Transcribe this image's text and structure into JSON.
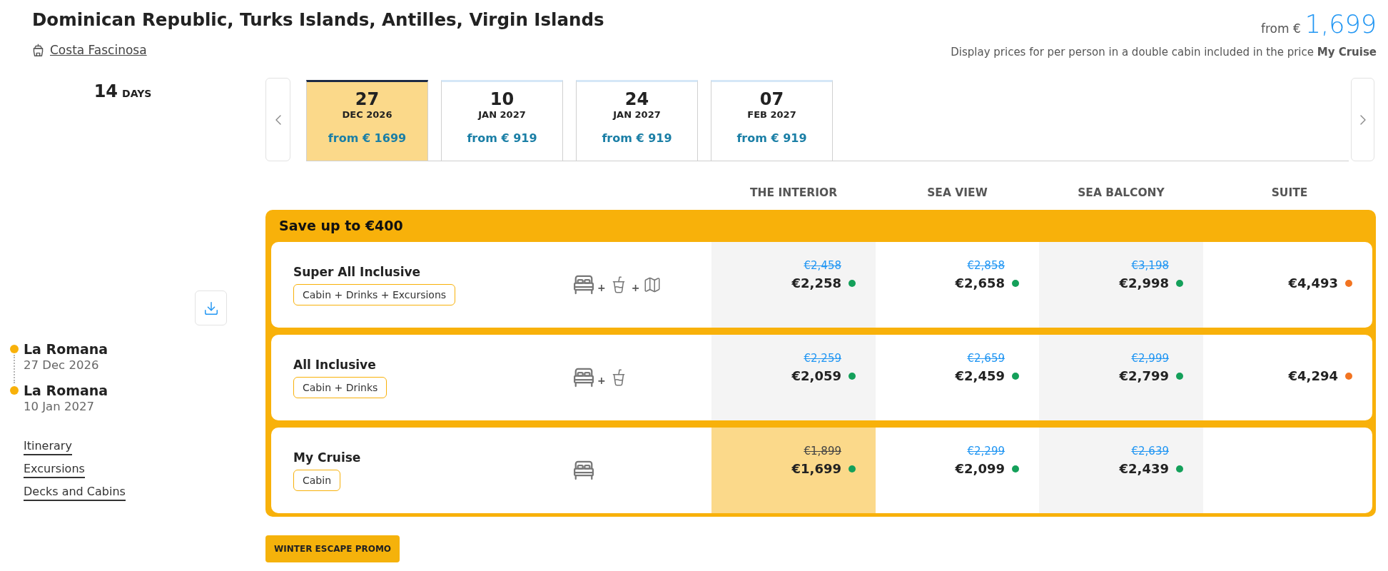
{
  "header": {
    "title": "Dominican Republic, Turks Islands, Antilles, Virgin Islands",
    "ship": "Costa Fascinosa",
    "from_label": "from €",
    "from_price": "1,699",
    "note": "Display prices for per person in a double cabin included in the price **My Cruise**"
  },
  "duration": {
    "number": "14",
    "unit": "DAYS"
  },
  "departures": [
    {
      "day": "27",
      "month": "DEC 2026",
      "price": "from € 1699",
      "selected": true
    },
    {
      "day": "10",
      "month": "JAN 2027",
      "price": "from € 919",
      "selected": false
    },
    {
      "day": "24",
      "month": "JAN 2027",
      "price": "from € 919",
      "selected": false
    },
    {
      "day": "07",
      "month": "FEB 2027",
      "price": "from € 919",
      "selected": false
    }
  ],
  "cabin_columns": [
    "THE INTERIOR",
    "SEA VIEW",
    "SEA BALCONY",
    "SUITE"
  ],
  "offer": {
    "title": "Save up to €400",
    "packages": [
      {
        "name": "Super All Inclusive",
        "tag": "Cabin + Drinks + Excursions",
        "includes": [
          {
            "kind": "cabin"
          },
          {
            "kind": "drinks",
            "joiner": "+"
          },
          {
            "kind": "excursions",
            "joiner": "+"
          }
        ],
        "prices": [
          {
            "old": "€2,458",
            "price": "€2,258",
            "color": "#14a05a",
            "selected": false
          },
          {
            "old": "€2,858",
            "price": "€2,658",
            "color": "#14a05a",
            "selected": false
          },
          {
            "old": "€3,198",
            "price": "€2,998",
            "color": "#14a05a",
            "selected": false
          },
          {
            "price": "€4,493",
            "color": "#f27421",
            "selected": false
          }
        ]
      },
      {
        "name": "All Inclusive",
        "tag": "Cabin + Drinks",
        "includes": [
          {
            "kind": "cabin"
          },
          {
            "kind": "drinks",
            "joiner": "+"
          }
        ],
        "prices": [
          {
            "old": "€2,259",
            "price": "€2,059",
            "color": "#14a05a",
            "selected": false
          },
          {
            "old": "€2,659",
            "price": "€2,459",
            "color": "#14a05a",
            "selected": false
          },
          {
            "old": "€2,999",
            "price": "€2,799",
            "color": "#14a05a",
            "selected": false
          },
          {
            "price": "€4,294",
            "color": "#f27421",
            "selected": false
          }
        ]
      },
      {
        "name": "My Cruise",
        "tag": "Cabin",
        "includes": [
          {
            "kind": "cabin"
          }
        ],
        "prices": [
          {
            "old": "€1,899",
            "price": "€1,699",
            "color": "#14a05a",
            "selected": true
          },
          {
            "old": "€2,299",
            "price": "€2,099",
            "color": "#14a05a",
            "selected": false
          },
          {
            "old": "€2,639",
            "price": "€2,439",
            "color": "#14a05a",
            "selected": false
          }
        ]
      }
    ]
  },
  "ports": [
    {
      "name": "La Romana",
      "date": "27 Dec 2026"
    },
    {
      "name": "La Romana",
      "date": "10 Jan 2027"
    }
  ],
  "links": [
    "Itinerary",
    "Excursions",
    "Decks and Cabins"
  ],
  "promo": "WINTER ESCAPE PROMO"
}
